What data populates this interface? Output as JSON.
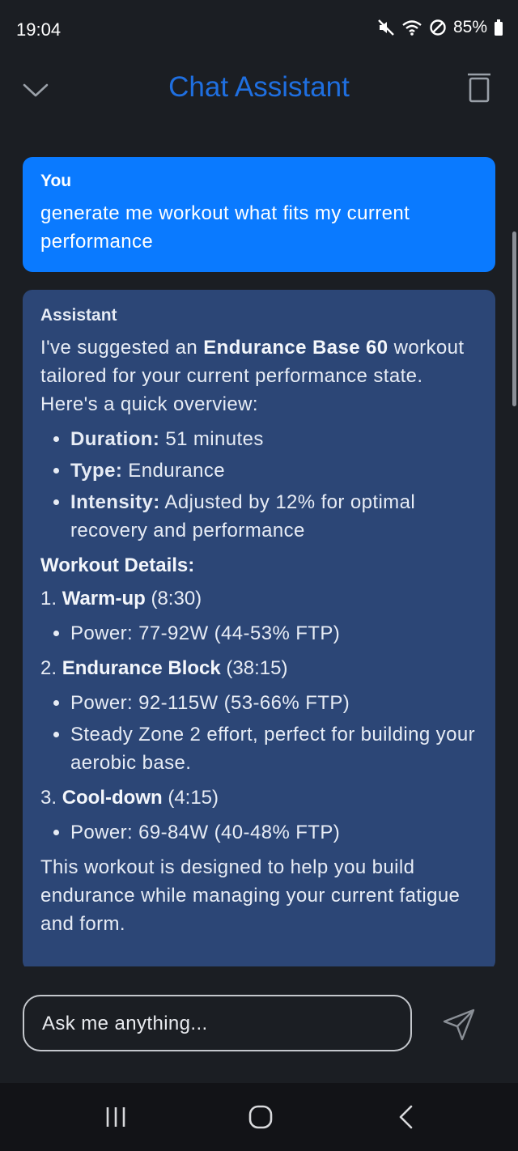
{
  "status": {
    "time": "19:04",
    "battery": "85%"
  },
  "header": {
    "title": "Chat Assistant"
  },
  "messages": {
    "user": {
      "sender": "You",
      "text": "generate me workout what fits my current performance"
    },
    "assistant": {
      "sender": "Assistant",
      "intro_pre": "I've suggested an ",
      "intro_bold": "Endurance Base 60",
      "intro_post": " workout tailored for your current performance state. Here's a quick overview:",
      "overview": [
        {
          "label": "Duration:",
          "value": " 51 minutes"
        },
        {
          "label": "Type:",
          "value": " Endurance"
        },
        {
          "label": "Intensity:",
          "value": " Adjusted by 12% for optimal recovery and performance"
        }
      ],
      "details_heading": "Workout Details:",
      "steps": [
        {
          "num": "1. ",
          "name": "Warm-up",
          "time": " (8:30)",
          "bullets": [
            "Power: 77-92W (44-53% FTP)"
          ]
        },
        {
          "num": "2. ",
          "name": "Endurance Block",
          "time": " (38:15)",
          "bullets": [
            "Power: 92-115W (53-66% FTP)",
            "Steady Zone 2 effort, perfect for building your aerobic base."
          ]
        },
        {
          "num": "3. ",
          "name": "Cool-down",
          "time": " (4:15)",
          "bullets": [
            "Power: 69-84W (40-48% FTP)"
          ]
        }
      ],
      "closing": "This workout is designed to help you build endurance while managing your current fatigue and form."
    }
  },
  "input": {
    "placeholder": "Ask me anything..."
  },
  "colors": {
    "accent": "#1f6fe0",
    "user_bubble": "#0a7aff",
    "assistant_bubble": "#2c4676",
    "background": "#1b1e23"
  },
  "icons": [
    "mute-icon",
    "wifi-icon",
    "dnd-icon",
    "battery-icon",
    "chevron-down-icon",
    "trash-icon",
    "send-icon",
    "recent-apps-icon",
    "home-icon",
    "back-icon"
  ]
}
